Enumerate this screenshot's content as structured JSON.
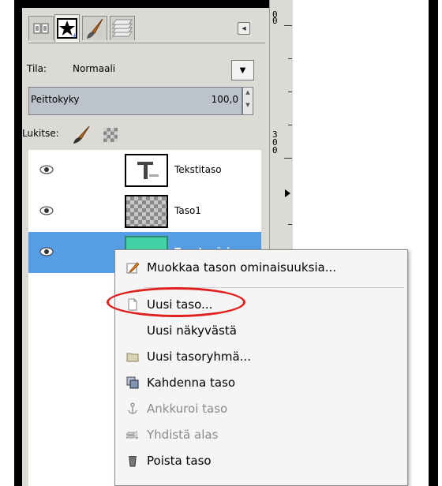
{
  "panel": {
    "tabs": [
      {
        "icon": "channels-icon"
      },
      {
        "icon": "brushes-star-icon"
      },
      {
        "icon": "paintbrush-icon"
      },
      {
        "icon": "layers-stack-icon"
      }
    ],
    "mode_label": "Tila:",
    "mode_value": "Normaali",
    "mode_dropdown_icon": "triangle-down",
    "opacity_label": "Peittokyky",
    "opacity_value": "100,0",
    "lock_label": "Lukitse:",
    "layers": [
      {
        "name": "Tekstitaso",
        "thumb": "text",
        "visible": true,
        "selected": false
      },
      {
        "name": "Taso1",
        "thumb": "checker",
        "visible": true,
        "selected": false
      },
      {
        "name": "Taustaväri",
        "thumb": "fill",
        "visible": true,
        "selected": true
      }
    ],
    "fill_color": "#44d1a6",
    "selection_color": "#569de5"
  },
  "ruler": {
    "numbers": [
      "0",
      "3\n0\n0"
    ]
  },
  "context_menu": {
    "items": [
      {
        "label": "Muokkaa tason ominaisuuksia...",
        "icon": "edit-pencil-icon",
        "enabled": true
      },
      {
        "label": "Uusi taso...",
        "icon": "new-page-icon",
        "enabled": true,
        "highlighted": true
      },
      {
        "label": "Uusi näkyvästä",
        "icon": "",
        "enabled": true
      },
      {
        "label": "Uusi tasoryhmä...",
        "icon": "folder-icon",
        "enabled": true
      },
      {
        "label": "Kahdenna taso",
        "icon": "duplicate-icon",
        "enabled": true
      },
      {
        "label": "Ankkuroi taso",
        "icon": "anchor-icon",
        "enabled": false
      },
      {
        "label": "Yhdistä alas",
        "icon": "merge-down-icon",
        "enabled": false
      },
      {
        "label": "Poista taso",
        "icon": "trash-icon",
        "enabled": true
      }
    ],
    "highlight_color": "#e0201e"
  }
}
